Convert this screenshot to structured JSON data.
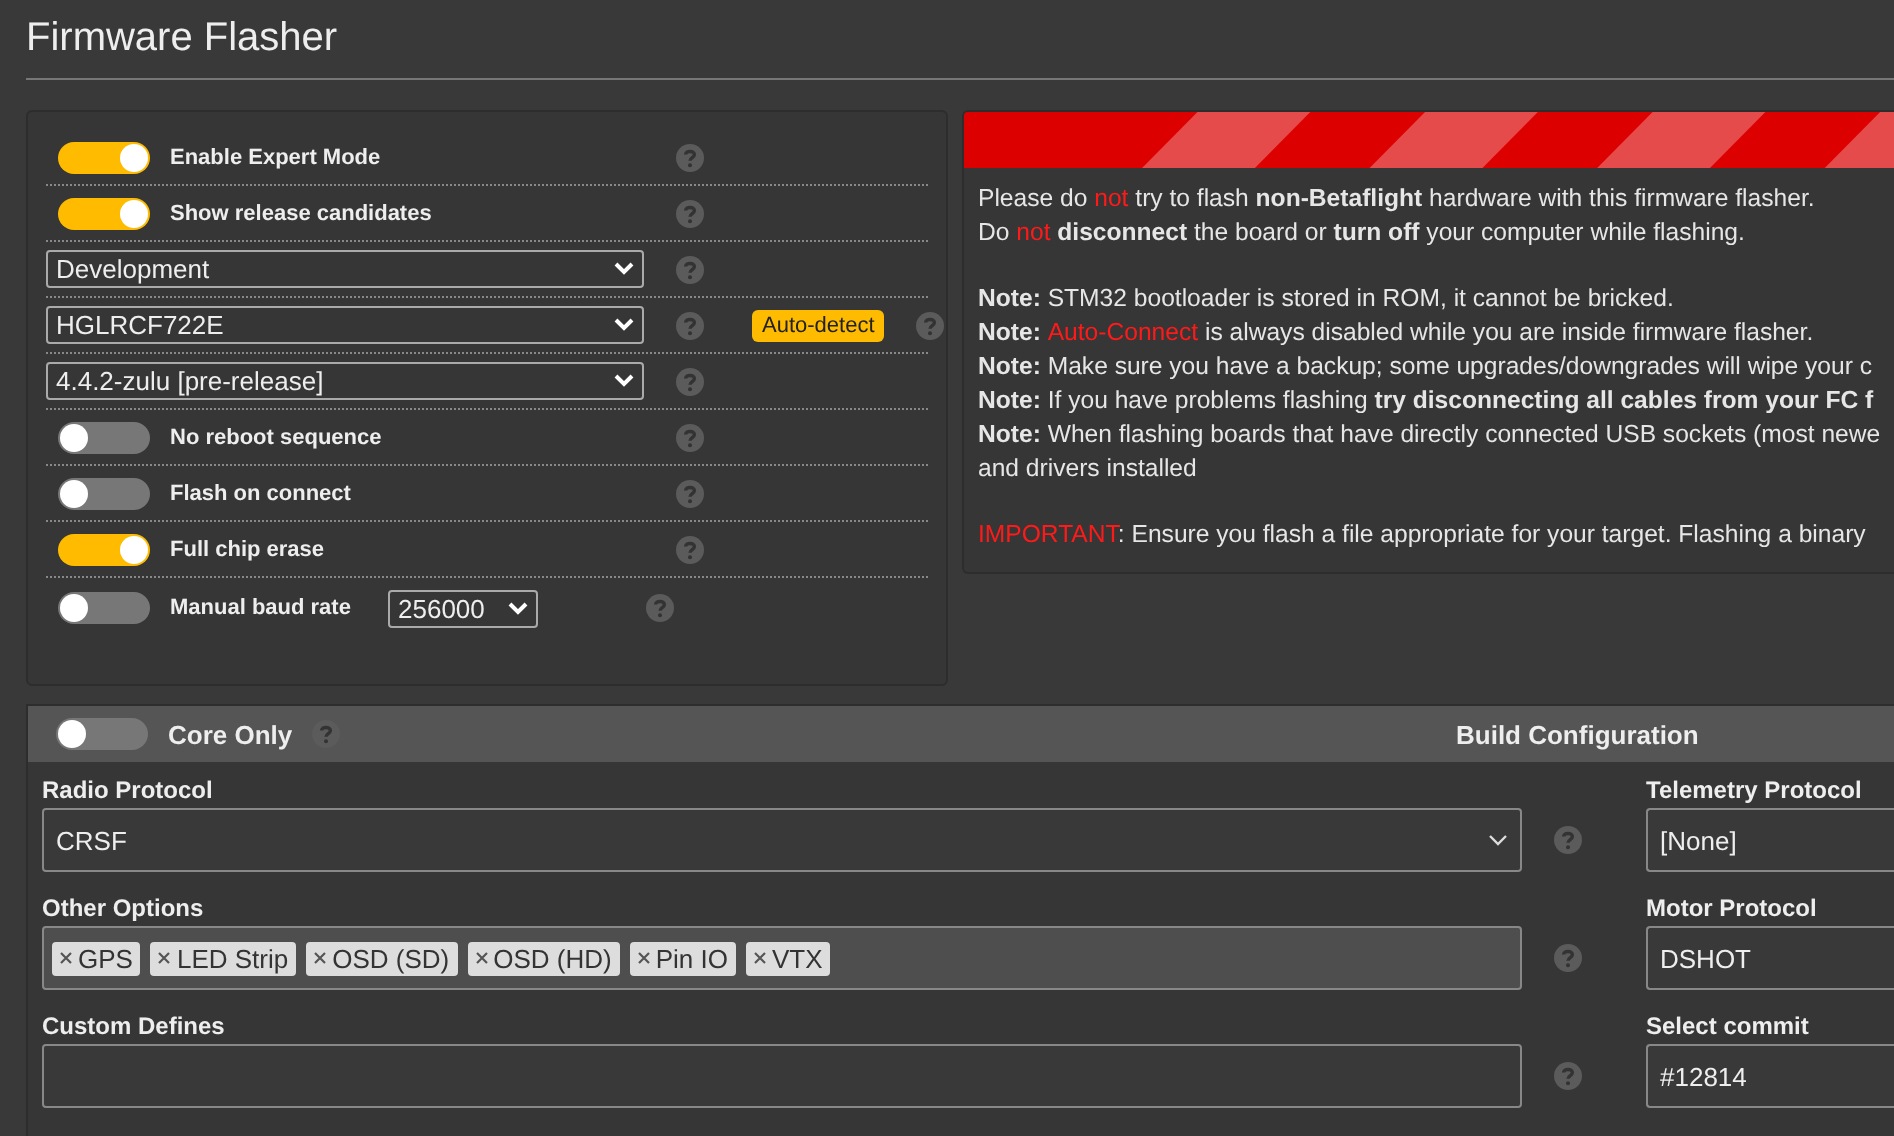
{
  "page": {
    "title": "Firmware Flasher"
  },
  "options": [
    {
      "kind": "toggle",
      "label": "Enable Expert Mode",
      "on": true
    },
    {
      "kind": "toggle",
      "label": "Show release candidates",
      "on": true
    },
    {
      "kind": "select",
      "value": "Development"
    },
    {
      "kind": "select",
      "value": "HGLRCF722E",
      "button": "Auto-detect"
    },
    {
      "kind": "select",
      "value": "4.4.2-zulu [pre-release]"
    },
    {
      "kind": "toggle",
      "label": "No reboot sequence",
      "on": false
    },
    {
      "kind": "toggle",
      "label": "Flash on connect",
      "on": false
    },
    {
      "kind": "toggle",
      "label": "Full chip erase",
      "on": true
    },
    {
      "kind": "toggle_select",
      "label": "Manual baud rate",
      "on": false,
      "value": "256000"
    }
  ],
  "warning": {
    "paragraphs": [
      [
        [
          {
            "kind": "plain",
            "text": "Please do "
          },
          {
            "kind": "alert",
            "text": "not"
          },
          {
            "kind": "plain",
            "text": " try to flash "
          },
          {
            "kind": "bold",
            "text": "non-Betaflight"
          },
          {
            "kind": "plain",
            "text": " hardware with this firmware flasher."
          }
        ],
        [
          {
            "kind": "plain",
            "text": "Do "
          },
          {
            "kind": "alert",
            "text": "not "
          },
          {
            "kind": "bold",
            "text": "disconnect"
          },
          {
            "kind": "plain",
            "text": " the board or "
          },
          {
            "kind": "bold",
            "text": "turn off"
          },
          {
            "kind": "plain",
            "text": " your computer while flashing."
          }
        ]
      ],
      [
        [
          {
            "kind": "bold",
            "text": "Note:"
          },
          {
            "kind": "plain",
            "text": " STM32 bootloader is stored in ROM, it cannot be bricked."
          }
        ],
        [
          {
            "kind": "bold",
            "text": "Note: "
          },
          {
            "kind": "alert",
            "text": "Auto-Connect"
          },
          {
            "kind": "plain",
            "text": " is always disabled while you are inside firmware flasher."
          }
        ],
        [
          {
            "kind": "bold",
            "text": "Note:"
          },
          {
            "kind": "plain",
            "text": " Make sure you have a backup; some upgrades/downgrades will wipe your c"
          }
        ],
        [
          {
            "kind": "bold",
            "text": "Note:"
          },
          {
            "kind": "plain",
            "text": " If you have problems flashing "
          },
          {
            "kind": "bold",
            "text": "try disconnecting all cables from your FC f"
          }
        ],
        [
          {
            "kind": "bold",
            "text": "Note:"
          },
          {
            "kind": "plain",
            "text": " When flashing boards that have directly connected USB sockets (most newe"
          }
        ],
        [
          {
            "kind": "plain",
            "text": "and drivers installed"
          }
        ]
      ],
      [
        [
          {
            "kind": "alert",
            "text": "IMPORTANT"
          },
          {
            "kind": "plain",
            "text": ": Ensure you flash a file appropriate for your target. Flashing a binary"
          }
        ]
      ]
    ]
  },
  "build": {
    "core_only": {
      "label": "Core Only",
      "on": false
    },
    "title": "Build Configuration",
    "left_fields": [
      {
        "kind": "select",
        "label": "Radio Protocol",
        "value": "CRSF"
      },
      {
        "kind": "tags",
        "label": "Other Options",
        "tags": [
          "GPS",
          "LED Strip",
          "OSD (SD)",
          "OSD (HD)",
          "Pin IO",
          "VTX"
        ]
      },
      {
        "kind": "text",
        "label": "Custom Defines"
      }
    ],
    "right_fields": [
      {
        "label": "Telemetry Protocol",
        "value": "[None]"
      },
      {
        "label": "Motor Protocol",
        "value": "DSHOT"
      },
      {
        "label": "Select commit",
        "value": "#12814"
      }
    ]
  }
}
